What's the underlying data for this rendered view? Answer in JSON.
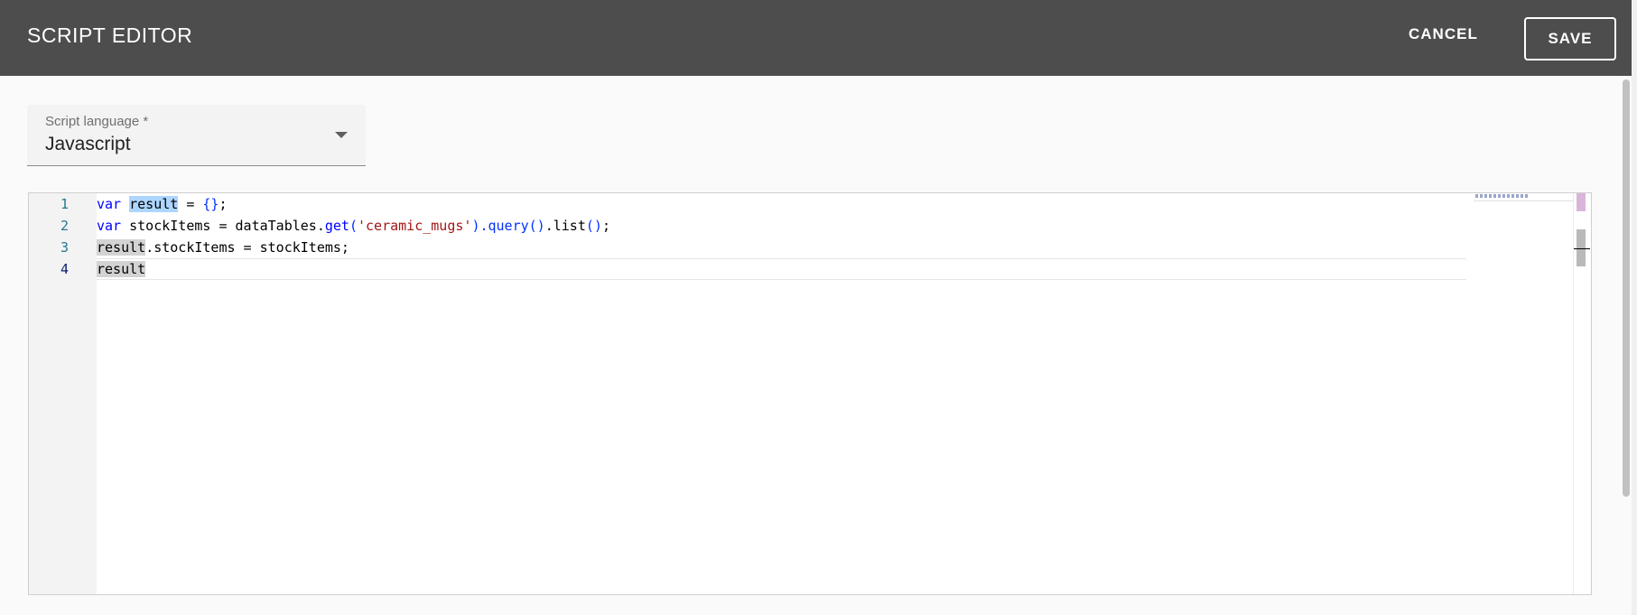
{
  "header": {
    "title": "SCRIPT EDITOR",
    "cancel_label": "CANCEL",
    "save_label": "SAVE"
  },
  "language_select": {
    "label": "Script language *",
    "value": "Javascript"
  },
  "editor": {
    "line_numbers": [
      "1",
      "2",
      "3",
      "4"
    ],
    "active_line": 4,
    "lines": [
      {
        "t1": "var",
        "t2": " ",
        "t3": "result",
        "t4": " = ",
        "t5": "{}",
        "t6": ";"
      },
      {
        "t1": "var",
        "t2": " stockItems = dataTables.",
        "t3": "get",
        "t4": "(",
        "t5": "'ceramic_mugs'",
        "t6": ").query",
        "t7": "()",
        "t8": ".list",
        "t9": "()",
        "t10": ";"
      },
      {
        "t1": "result",
        "t2": ".stockItems = stockItems;"
      },
      {
        "t1": "result"
      }
    ]
  },
  "colors": {
    "header_bg": "#4d4d4d",
    "keyword": "#0000ff",
    "string": "#a31515",
    "line_number": "#237893"
  }
}
